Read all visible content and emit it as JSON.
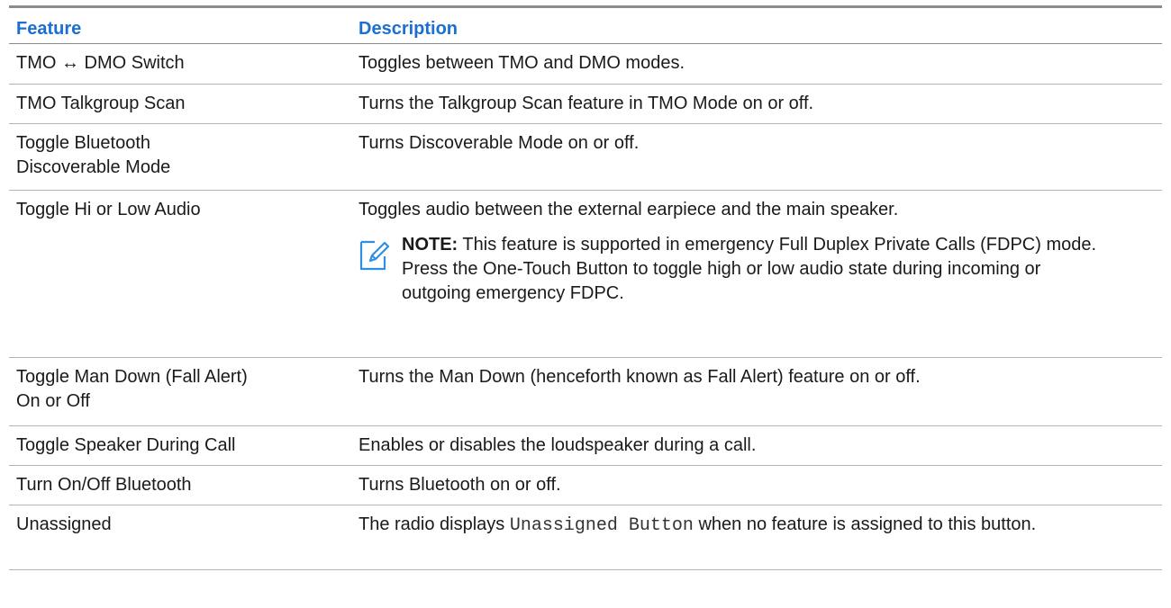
{
  "headers": {
    "feature": "Feature",
    "description": "Description"
  },
  "rows": [
    {
      "feature": "TMO ↔ DMO Switch",
      "description": "Toggles between TMO and DMO modes."
    },
    {
      "feature": "TMO Talkgroup Scan",
      "description": "Turns the Talkgroup Scan feature in TMO Mode on or off."
    },
    {
      "feature": "Toggle Bluetooth Discoverable Mode",
      "description": "Turns Discoverable Mode on or off."
    },
    {
      "feature": "Toggle Hi or Low Audio",
      "description": "Toggles audio between the external earpiece and the main speaker.",
      "note": {
        "label": "NOTE:",
        "text": "This feature is supported in emergency Full Duplex Private Calls (FDPC) mode. Press the One-Touch Button to toggle high or low audio state during incoming or outgoing emergency FDPC."
      }
    },
    {
      "feature": "Toggle Man Down (Fall Alert) On or Off",
      "description": "Turns the Man Down (henceforth known as Fall Alert) feature on or off."
    },
    {
      "feature": "Toggle Speaker During Call",
      "description": "Enables or disables the loudspeaker during a call."
    },
    {
      "feature": "Turn On/Off Bluetooth",
      "description": "Turns Bluetooth on or off."
    },
    {
      "feature": "Unassigned",
      "description_prefix": "The radio displays",
      "description_code": "Unassigned Button",
      "description_suffix": "when no feature is assigned to this button."
    }
  ],
  "icons": {
    "note": "pencil-note-icon"
  },
  "colors": {
    "header_text": "#1a6fd0",
    "note_icon": "#2f8fe6",
    "rule": "#8c8c8c"
  }
}
